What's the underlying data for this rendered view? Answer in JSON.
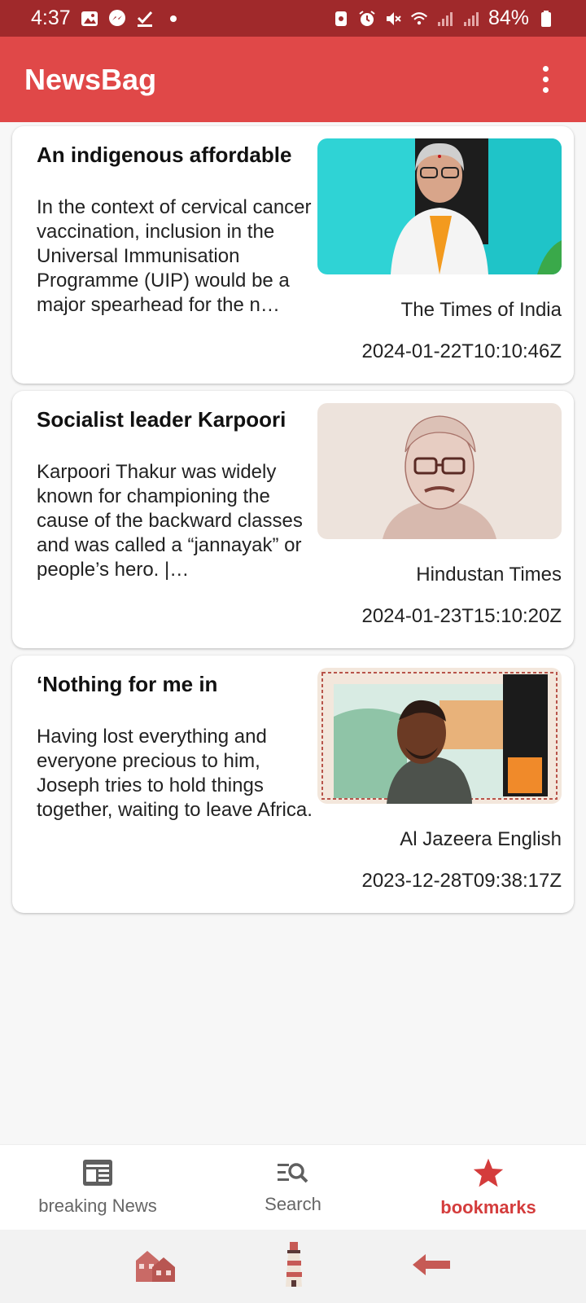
{
  "status_bar": {
    "time": "4:37",
    "battery": "84%",
    "left_icons": [
      "gallery-icon",
      "messenger-icon",
      "check-icon"
    ],
    "right_icons": [
      "nfc-icon",
      "alarm-icon",
      "mute-icon",
      "wifi-icon",
      "signal-icon",
      "signal-icon",
      "battery-icon"
    ]
  },
  "app_bar": {
    "title": "NewsBag"
  },
  "articles": [
    {
      "title": "An indigenous affordable",
      "description": "In the context of cervical cancer vaccination, inclusion in the Universal Immunisation Programme (UIP) would be a major spearhead for the n…",
      "source": "The Times of India",
      "date": "2024-01-22T10:10:46Z"
    },
    {
      "title": "Socialist leader Karpoori",
      "description": "Karpoori Thakur was widely known for championing the cause of the backward classes and was called a “jannayak” or people’s hero. |…",
      "source": "Hindustan Times",
      "date": "2024-01-23T15:10:20Z"
    },
    {
      "title": "‘Nothing for me in",
      "description": "Having lost everything and everyone precious to him, Joseph tries to hold things together, waiting to leave Africa.",
      "source": "Al Jazeera English",
      "date": "2023-12-28T09:38:17Z"
    }
  ],
  "bottom_nav": {
    "items": [
      {
        "label": "breaking News",
        "icon": "newspaper-icon"
      },
      {
        "label": "Search",
        "icon": "search-list-icon"
      },
      {
        "label": "bookmarks",
        "icon": "star-icon"
      }
    ],
    "active": "bookmarks"
  },
  "colors": {
    "status_bar": "#a0292b",
    "app_bar": "#e04848",
    "accent": "#d43c3c"
  }
}
